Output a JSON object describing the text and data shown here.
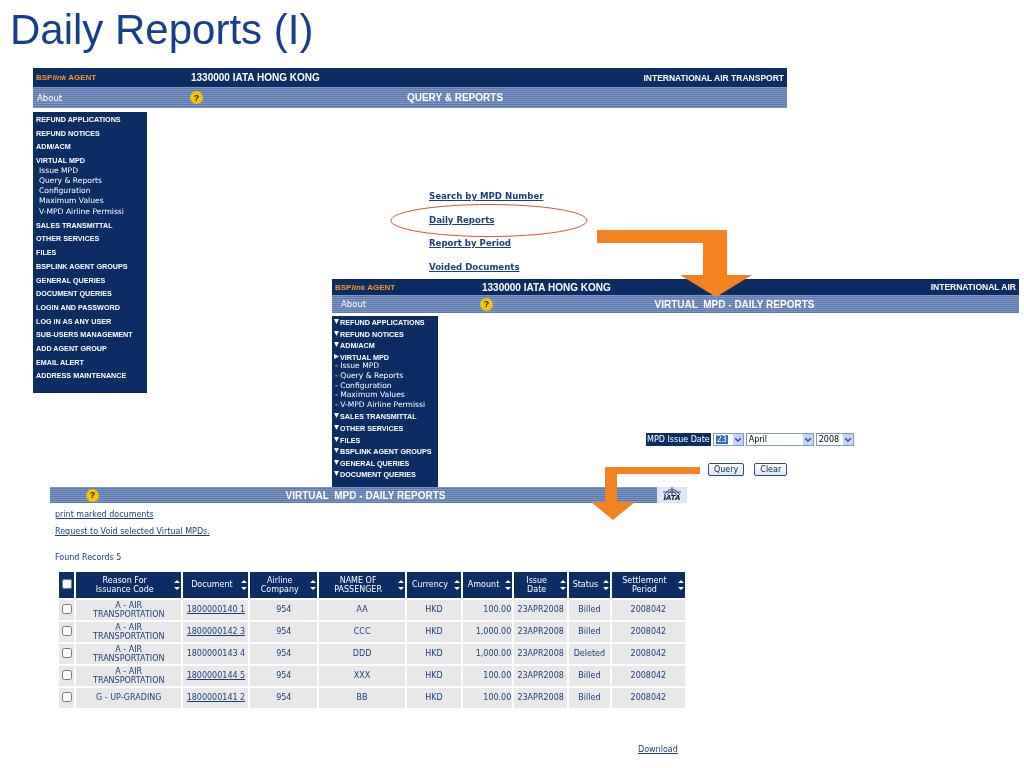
{
  "slide_title": "Daily Reports (I)",
  "screen_1": {
    "header": {
      "brand": {
        "lead": "BSP",
        "italic": "link",
        "tail": " AGENT"
      },
      "agent": "1330000 IATA HONG KONG",
      "org": "INTERNATIONAL AIR TRANSPORT"
    },
    "nav": {
      "about": "About",
      "help": "?",
      "title": "QUERY & REPORTS"
    },
    "sidebar": [
      {
        "label": "REFUND APPLICATIONS"
      },
      {
        "label": "REFUND NOTICES"
      },
      {
        "label": "ADM/ACM"
      },
      {
        "label": "VIRTUAL MPD",
        "children": [
          {
            "label": "Issue MPD"
          },
          {
            "label": "Query & Reports"
          },
          {
            "label": "Configuration"
          },
          {
            "label": "Maximum Values"
          },
          {
            "label": "V-MPD Airline Permissi"
          }
        ]
      },
      {
        "label": "SALES TRANSMITTAL"
      },
      {
        "label": "OTHER SERVICES"
      },
      {
        "label": "FILES"
      },
      {
        "label": "BSPLINK AGENT GROUPS"
      },
      {
        "label": "GENERAL QUERIES"
      },
      {
        "label": "DOCUMENT QUERIES"
      },
      {
        "label": "LOGIN AND PASSWORD"
      },
      {
        "label": "LOG IN AS ANY USER"
      },
      {
        "label": "SUB-USERS MANAGEMENT"
      },
      {
        "label": "ADD AGENT GROUP"
      },
      {
        "label": "EMAIL ALERT"
      },
      {
        "label": "ADDRESS MAINTENANCE"
      }
    ],
    "links": [
      {
        "label": "Search by MPD Number",
        "highlighted": false
      },
      {
        "label": "Daily Reports",
        "highlighted": true
      },
      {
        "label": "Report by Period",
        "highlighted": false
      },
      {
        "label": "Voided Documents",
        "highlighted": false
      }
    ]
  },
  "screen_2": {
    "header": {
      "brand": {
        "lead": "BSP",
        "italic": "link",
        "tail": " AGENT"
      },
      "agent": "1330000 IATA HONG KONG",
      "org": "INTERNATIONAL AIR"
    },
    "nav": {
      "about": "About",
      "help": "?",
      "title": "VIRTUAL  MPD - DAILY REPORTS"
    },
    "sidebar": [
      {
        "label": "REFUND APPLICATIONS",
        "expanded": false
      },
      {
        "label": "REFUND NOTICES",
        "expanded": false
      },
      {
        "label": "ADM/ACM",
        "expanded": false
      },
      {
        "label": "VIRTUAL MPD",
        "expanded": true,
        "children": [
          {
            "label": "- Issue MPD"
          },
          {
            "label": "- Query & Reports"
          },
          {
            "label": "- Configuration"
          },
          {
            "label": "- Maximum Values"
          },
          {
            "label": "- V-MPD Airline Permissi"
          }
        ]
      },
      {
        "label": "SALES TRANSMITTAL",
        "expanded": false
      },
      {
        "label": "OTHER SERVICES",
        "expanded": false
      },
      {
        "label": "FILES",
        "expanded": false
      },
      {
        "label": "BSPLINK AGENT GROUPS",
        "expanded": false
      },
      {
        "label": "GENERAL QUERIES",
        "expanded": false
      },
      {
        "label": "DOCUMENT QUERIES",
        "expanded": false
      }
    ],
    "form": {
      "label": "MPD Issue Date",
      "day": "23",
      "month": "April",
      "year": "2008"
    },
    "buttons": [
      "Query",
      "Clear"
    ]
  },
  "screen_3": {
    "nav": {
      "help": "?",
      "title": "VIRTUAL  MPD - DAILY REPORTS",
      "logo": "IATA"
    },
    "links": [
      "print marked documents",
      "Request to Void selected Virtual MPDs."
    ],
    "found": "Found Records 5",
    "table": {
      "select_all": {
        "checked": false
      },
      "columns": [
        "Reason For\nIssuance Code",
        "Document",
        "Airline\nCompany",
        "NAME OF\nPASSENGER",
        "Currency",
        "Amount",
        "Issue\nDate",
        "Status",
        "Settlement\nPeriod"
      ],
      "rows": [
        {
          "checked": false,
          "reason": "A - AIR\nTRANSPORTATION",
          "document": "1800000140 1",
          "document_link": true,
          "airline": "954",
          "passenger": "AA",
          "currency": "HKD",
          "amount": "100.00",
          "issue_date": "23APR2008",
          "status": "Billed",
          "period": "2008042"
        },
        {
          "checked": false,
          "reason": "A - AIR\nTRANSPORTATION",
          "document": "1800000142 3",
          "document_link": true,
          "airline": "954",
          "passenger": "CCC",
          "currency": "HKD",
          "amount": "1,000.00",
          "issue_date": "23APR2008",
          "status": "Billed",
          "period": "2008042"
        },
        {
          "checked": false,
          "reason": "A - AIR\nTRANSPORTATION",
          "document": "1800000143 4",
          "document_link": false,
          "airline": "954",
          "passenger": "DDD",
          "currency": "HKD",
          "amount": "1,000.00",
          "issue_date": "23APR2008",
          "status": "Deleted",
          "period": "2008042"
        },
        {
          "checked": false,
          "reason": "A - AIR\nTRANSPORTATION",
          "document": "1800000144 5",
          "document_link": true,
          "airline": "954",
          "passenger": "XXX",
          "currency": "HKD",
          "amount": "100.00",
          "issue_date": "23APR2008",
          "status": "Billed",
          "period": "2008042"
        },
        {
          "checked": false,
          "reason": "G - UP-GRADING",
          "document": "1800000141 2",
          "document_link": true,
          "airline": "954",
          "passenger": "BB",
          "currency": "HKD",
          "amount": "100.00",
          "issue_date": "23APR2008",
          "status": "Billed",
          "period": "2008042"
        }
      ]
    },
    "download": "Download"
  }
}
